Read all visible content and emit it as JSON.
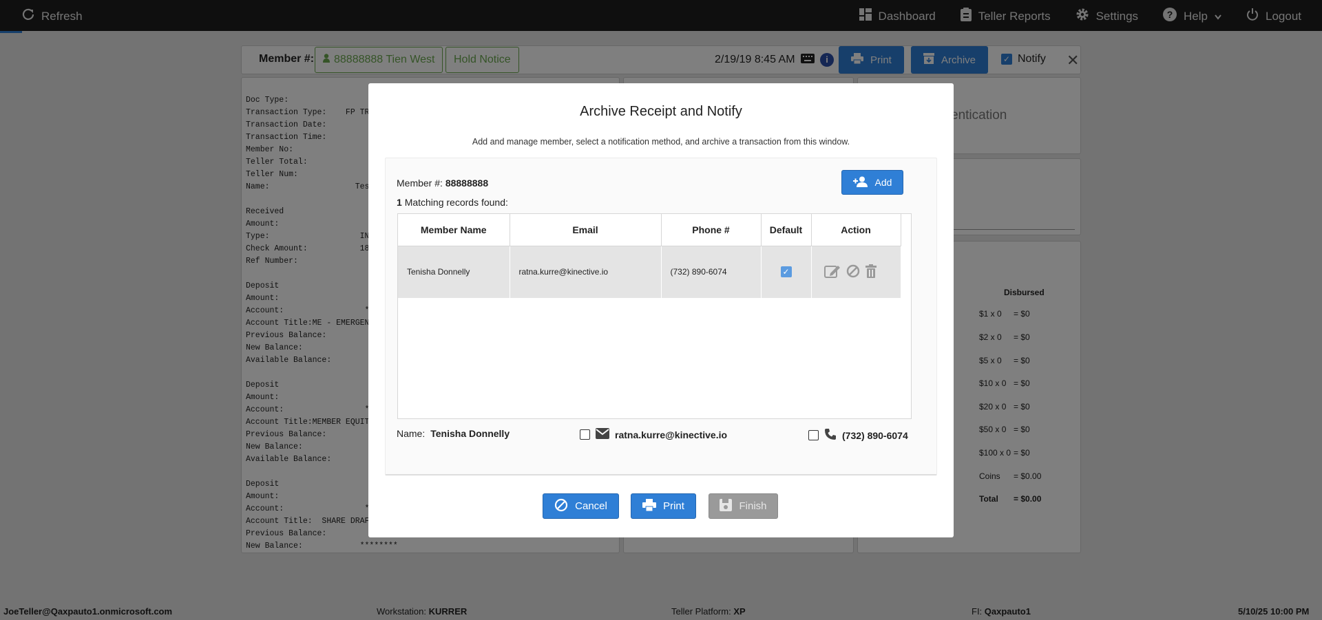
{
  "topbar": {
    "refresh": "Refresh",
    "nav": [
      {
        "label": "Dashboard",
        "icon": "dashboard-icon"
      },
      {
        "label": "Teller Reports",
        "icon": "clipboard-icon"
      },
      {
        "label": "Settings",
        "icon": "gear-icon"
      },
      {
        "label": "Help",
        "icon": "help-icon"
      },
      {
        "label": "Logout",
        "icon": "power-icon"
      }
    ]
  },
  "member_bar": {
    "label": "Member #:",
    "member_button": "88888888 Tien West",
    "hold_notice": "Hold Notice",
    "datetime": "2/19/19 8:45 AM",
    "print": "Print",
    "archive": "Archive",
    "notify": "Notify"
  },
  "receipt_text": "Doc Type:\nTransaction Type:    FP TRA\nTransaction Date:\nTransaction Time:\nMember No:\nTeller Total:\nTeller Num:\nName:                  Tes\n\nReceived\nAmount:\nType:                   IN\nCheck Amount:           18\nRef Number:\n\nDeposit\nAmount:\nAccount:                 *\nAccount Title:ME - EMERGENC\nPrevious Balance:\nNew Balance:\nAvailable Balance:\n\nDeposit\nAmount:\nAccount:                 *\nAccount Title:MEMBER EQUITY\nPrevious Balance:\nNew Balance:\nAvailable Balance:\n\nDeposit\nAmount:\nAccount:                 *\nAccount Title:  SHARE DRAFT\nPrevious Balance:\nNew Balance:            ********",
  "right_panel": {
    "auth_fragment": "entication",
    "disbursed_header": "Disbursed",
    "rows": [
      {
        "denom": "$1 x 0",
        "value": "= $0"
      },
      {
        "denom": "$2 x 0",
        "value": "= $0"
      },
      {
        "denom": "$5 x 0",
        "value": "= $0"
      },
      {
        "denom": "$10 x 0",
        "value": "= $0"
      },
      {
        "denom": "$20 x 0",
        "value": "= $0"
      },
      {
        "denom": "$50 x 0",
        "value": "= $0"
      },
      {
        "denom": "$100 x 0",
        "value": "= $0"
      },
      {
        "denom": "Coins",
        "value": "= $0.00"
      },
      {
        "denom": "Total",
        "value": "= $0.00"
      }
    ]
  },
  "statusbar": {
    "user": "JoeTeller@Qaxpauto1.onmicrosoft.com",
    "workstation_label": "Workstation:",
    "workstation": "KURRER",
    "platform_label": "Teller Platform:",
    "platform": "XP",
    "fi_label": "FI:",
    "fi": "Qaxpauto1",
    "datetime": "5/10/25 10:00 PM"
  },
  "modal": {
    "title": "Archive Receipt and Notify",
    "subtitle": "Add and manage member, select a notification method, and archive a transaction from this window.",
    "member_label": "Member #:",
    "member_no": "88888888",
    "match_count": "1",
    "match_text": "Matching records found:",
    "add_button": "Add",
    "columns": [
      "Member Name",
      "Email",
      "Phone #",
      "Default",
      "Action"
    ],
    "rows": [
      {
        "name": "Tenisha Donnelly",
        "email": "ratna.kurre@kinective.io",
        "phone": "(732) 890-6074",
        "default": true
      }
    ],
    "selected": {
      "name_label": "Name:",
      "name": "Tenisha Donnelly",
      "email": "ratna.kurre@kinective.io",
      "phone": "(732) 890-6074",
      "email_checked": false,
      "phone_checked": false
    },
    "buttons": {
      "cancel": "Cancel",
      "print": "Print",
      "finish": "Finish"
    }
  }
}
